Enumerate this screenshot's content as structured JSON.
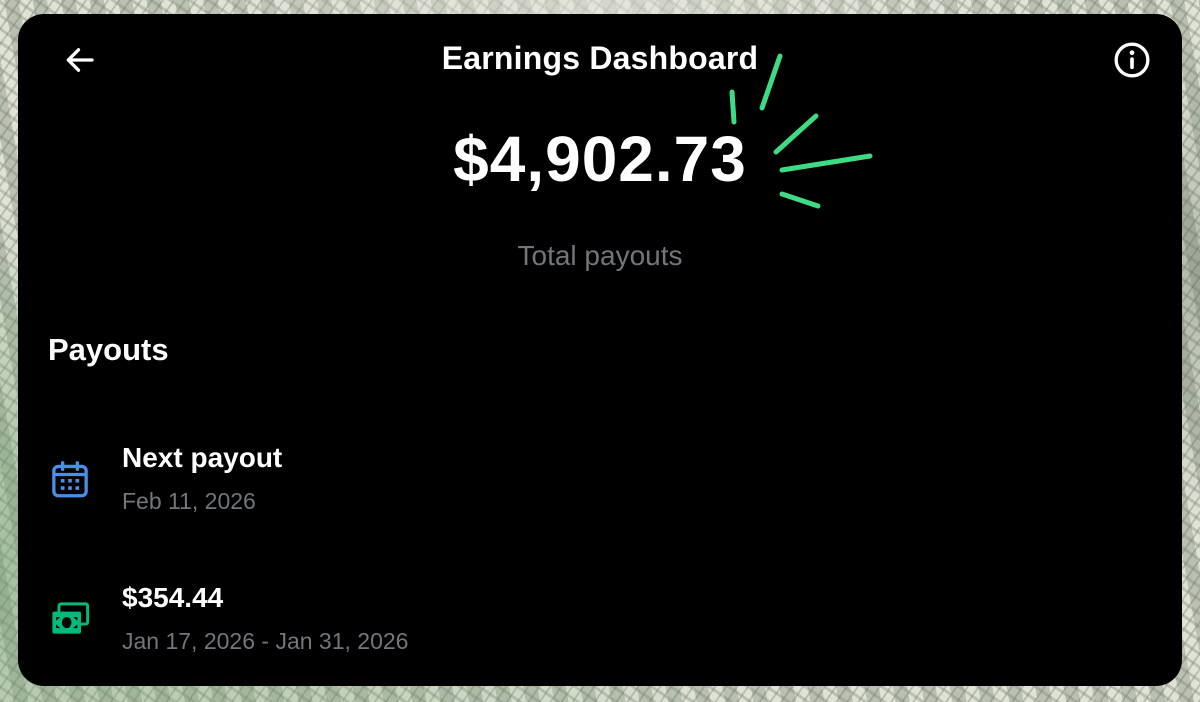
{
  "header": {
    "title": "Earnings Dashboard",
    "back_icon": "arrow-left-icon",
    "info_icon": "info-circle-icon"
  },
  "summary": {
    "total_amount": "$4,902.73",
    "total_label": "Total payouts"
  },
  "payouts": {
    "section_title": "Payouts",
    "next": {
      "icon": "calendar-icon",
      "title": "Next payout",
      "date": "Feb 11, 2026"
    },
    "items": [
      {
        "icon": "cash-icon",
        "amount": "$354.44",
        "period": "Jan 17, 2026 - Jan 31, 2026"
      }
    ]
  },
  "colors": {
    "card_background": "#000000",
    "text_primary": "#ffffff",
    "text_secondary": "#71767b",
    "calendar_icon": "#4a8fe7",
    "cash_icon": "#00ba7c",
    "sparkle": "#3ddc84"
  }
}
